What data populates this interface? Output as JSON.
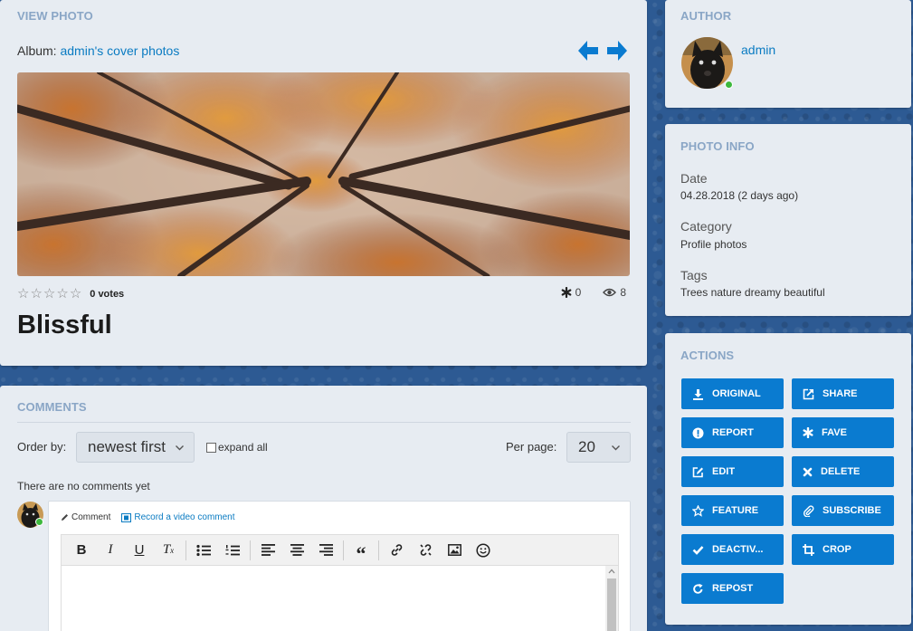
{
  "view": {
    "title": "VIEW PHOTO",
    "album_label": "Album:",
    "album_name": "admin's cover photos",
    "votes": "0 votes",
    "favs": "0",
    "views": "8",
    "photo_title": "Blissful",
    "rating": 0
  },
  "comments": {
    "title": "COMMENTS",
    "order_label": "Order by:",
    "order_value": "newest first",
    "expand_label": "expand all",
    "per_page_label": "Per page:",
    "per_page_value": "20",
    "empty_text": "There are no comments yet",
    "tab_comment": "Comment",
    "tab_video": "Record a video comment"
  },
  "author": {
    "title": "AUTHOR",
    "name": "admin"
  },
  "info": {
    "title": "PHOTO INFO",
    "date_label": "Date",
    "date_value": "04.28.2018 (2 days ago)",
    "category_label": "Category",
    "category_value": "Profile photos",
    "tags_label": "Tags",
    "tags_value": "Trees nature dreamy beautiful"
  },
  "actions": {
    "title": "ACTIONS",
    "original": "ORIGINAL",
    "share": "SHARE",
    "report": "REPORT",
    "fave": "FAVE",
    "edit": "EDIT",
    "delete": "DELETE",
    "feature": "FEATURE",
    "subscribe": "SUBSCRIBE",
    "deactivate": "DEACTIV...",
    "crop": "CROP",
    "repost": "REPOST"
  },
  "colors": {
    "accent": "#0a7bd0",
    "link": "#0a7bc2",
    "online": "#3db83d",
    "panel": "#e7ecf2"
  }
}
